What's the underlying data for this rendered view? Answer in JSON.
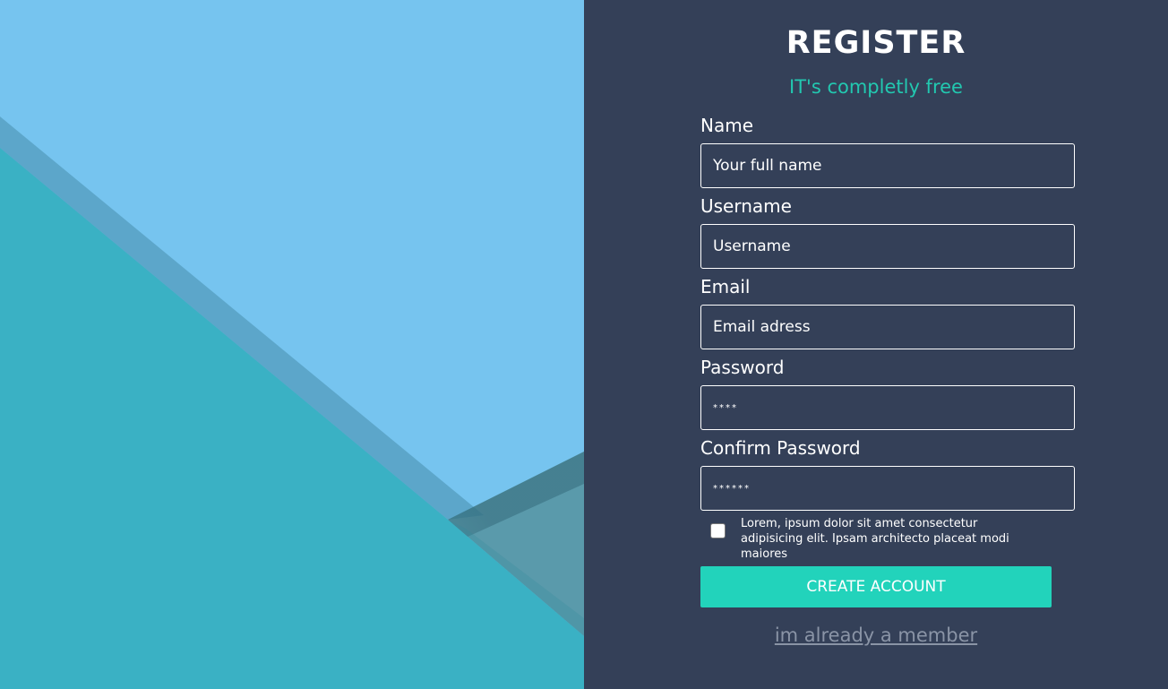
{
  "form": {
    "title": "REGISTER",
    "subtitle": "IT's completly free",
    "fields": [
      {
        "label": "Name",
        "placeholder": "Your full name"
      },
      {
        "label": "Username",
        "placeholder": "Username"
      },
      {
        "label": "Email",
        "placeholder": "Email adress"
      },
      {
        "label": "Password",
        "placeholder": "****"
      },
      {
        "label": "Confirm Password",
        "placeholder": "******"
      }
    ],
    "terms_text": "Lorem, ipsum dolor sit amet consectetur adipisicing elit. Ipsam architecto placeat modi maiores",
    "terms_checked": false,
    "submit_label": "CREATE ACCOUNT",
    "member_link": "im already a member"
  },
  "colors": {
    "panel_bg": "#344058",
    "accent": "#22d3bb",
    "subtitle": "#22c8b0",
    "art_sky": "#76c4ef",
    "art_teal": "#3ab1c4",
    "art_grey": "#5a9aab"
  }
}
